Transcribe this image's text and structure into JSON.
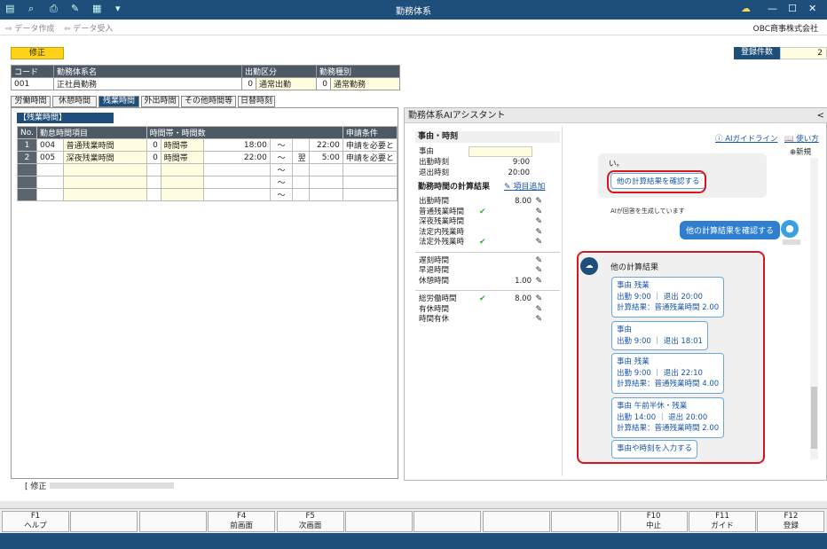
{
  "window": {
    "title": "勤務体系",
    "company": "OBC商事株式会社"
  },
  "toolbar": {
    "create": "データ作成",
    "import": "データ受入"
  },
  "mode_badge": "修正",
  "registration": {
    "label": "登録件数",
    "value": "2"
  },
  "header": {
    "col_code": "コード",
    "col_name": "勤務体系名",
    "col_attend": "出勤区分",
    "col_type": "勤務種別",
    "code": "001",
    "name": "正社員勤務",
    "attend_no": "0",
    "attend_label": "通常出勤",
    "type_no": "0",
    "type_label": "通常勤務"
  },
  "tabs": [
    "労働時間",
    "休憩時間",
    "残業時間",
    "外出時間",
    "その他時間等",
    "日替時刻"
  ],
  "section_title": "【残業時間】",
  "grid": {
    "headers": [
      "No.",
      "勤怠時間項目",
      "時間帯・時間数",
      "申請条件"
    ],
    "rows": [
      {
        "no": "1",
        "code": "004",
        "item": "普通残業時間",
        "flag": "0",
        "mode": "時間帯",
        "from": "18:00",
        "sep": "～",
        "next": "",
        "to": "22:00",
        "cond": "申請を必要と"
      },
      {
        "no": "2",
        "code": "005",
        "item": "深夜残業時間",
        "flag": "0",
        "mode": "時間帯",
        "from": "22:00",
        "sep": "～",
        "next": "翌",
        "to": "5:00",
        "cond": "申請を必要と"
      },
      {
        "no": "",
        "code": "",
        "item": "",
        "flag": "",
        "mode": "",
        "from": "",
        "sep": "～",
        "next": "",
        "to": "",
        "cond": ""
      },
      {
        "no": "",
        "code": "",
        "item": "",
        "flag": "",
        "mode": "",
        "from": "",
        "sep": "～",
        "next": "",
        "to": "",
        "cond": ""
      },
      {
        "no": "",
        "code": "",
        "item": "",
        "flag": "",
        "mode": "",
        "from": "",
        "sep": "～",
        "next": "",
        "to": "",
        "cond": ""
      }
    ]
  },
  "statusline": "[ 修正",
  "ai": {
    "title": "勤務体系AIアシスタント",
    "collapse": "<",
    "sec1": "事由・時刻",
    "reason_label": "事由",
    "in_label": "出勤時刻",
    "in_val": "9:00",
    "out_label": "退出時刻",
    "out_val": "20:00",
    "sec2": "勤務時間の計算結果",
    "add_item": "項目追加",
    "results1": [
      {
        "label": "出勤時間",
        "val": "8.00",
        "chk": false
      },
      {
        "label": "普通残業時間",
        "val": "",
        "chk": true
      },
      {
        "label": "深夜残業時間",
        "val": "",
        "chk": false
      },
      {
        "label": "法定内残業時",
        "val": "",
        "chk": false
      },
      {
        "label": "法定外残業時",
        "val": "",
        "chk": true
      }
    ],
    "results2": [
      {
        "label": "遅刻時間",
        "val": "",
        "chk": false
      },
      {
        "label": "早退時間",
        "val": "",
        "chk": false
      },
      {
        "label": "休憩時間",
        "val": "1.00",
        "chk": false
      }
    ],
    "results3": [
      {
        "label": "総労働時間",
        "val": "8.00",
        "chk": true
      },
      {
        "label": "有休時間",
        "val": "",
        "chk": false
      },
      {
        "label": "時間有休",
        "val": "",
        "chk": false
      }
    ],
    "guide_link": "AIガイドライン",
    "usage_link": "使い方",
    "new_label": "新規",
    "prev_text": "い。",
    "confirm_btn": "他の計算結果を確認する",
    "generating": "AIが回答を生成しています",
    "user_msg": "他の計算結果を確認する",
    "reply_title": "他の計算結果",
    "cards": [
      [
        "事由 残業",
        "出勤  9:00 ｜ 退出 20:00",
        "計算結果：普通残業時間  2.00"
      ],
      [
        "事由",
        "出勤  9:00 ｜ 退出 18:01"
      ],
      [
        "事由 残業",
        "出勤  9:00 ｜ 退出 22:10",
        "計算結果：普通残業時間  4.00"
      ],
      [
        "事由 午前半休・残業",
        "出勤 14:00 ｜ 退出 20:00",
        "計算結果：普通残業時間  2.00"
      ],
      [
        "事由や時刻を入力する"
      ]
    ]
  },
  "fkeys": [
    {
      "key": "F1",
      "label": "ヘルプ"
    },
    {
      "key": "",
      "label": ""
    },
    {
      "key": "",
      "label": ""
    },
    {
      "key": "F4",
      "label": "前画面"
    },
    {
      "key": "F5",
      "label": "次画面"
    },
    {
      "key": "",
      "label": ""
    },
    {
      "key": "",
      "label": ""
    },
    {
      "key": "",
      "label": ""
    },
    {
      "key": "",
      "label": ""
    },
    {
      "key": "F10",
      "label": "中止"
    },
    {
      "key": "F11",
      "label": "ガイド"
    },
    {
      "key": "F12",
      "label": "登録"
    }
  ],
  "colors": {
    "titlebar": "#1e4e7a",
    "accent": "#2f7fd1",
    "highlight": "#d8161e",
    "badge": "#ffd21a"
  }
}
